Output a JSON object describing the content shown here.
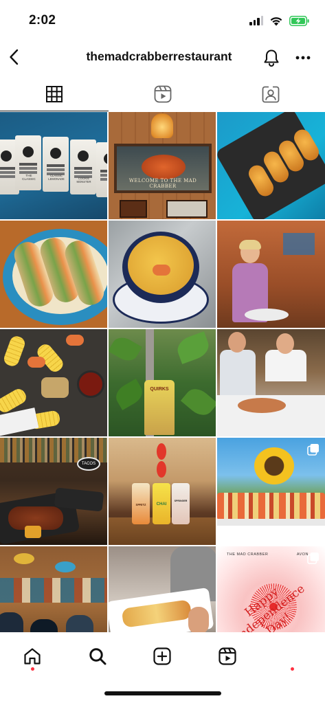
{
  "status_bar": {
    "time": "2:02",
    "signal_icon": "cellular-signal-icon",
    "wifi_icon": "wifi-icon",
    "battery_icon": "battery-charging-icon",
    "battery_color": "#32c759"
  },
  "header": {
    "back_icon": "chevron-left-icon",
    "username": "themadcrabberrestaurant",
    "notifications_icon": "bell-icon",
    "more_icon": "more-horizontal-icon"
  },
  "tabs": [
    {
      "name": "posts",
      "icon": "grid-icon",
      "active": true
    },
    {
      "name": "reels",
      "icon": "reels-icon",
      "active": false
    },
    {
      "name": "tagged",
      "icon": "tagged-person-icon",
      "active": false
    }
  ],
  "posts": [
    {
      "subject": "coffee bags",
      "labels": [
        "THE CLASSIC",
        "CLASSIC LEMONADE",
        "COOKIE MONSTER"
      ]
    },
    {
      "subject": "welcome sign",
      "sign_text": "WELCOME TO THE MAD CRABBER"
    },
    {
      "subject": "stuffed potatoes"
    },
    {
      "subject": "tacos"
    },
    {
      "subject": "soup bowl"
    },
    {
      "subject": "server with plate"
    },
    {
      "subject": "seafood boil"
    },
    {
      "subject": "garden plants",
      "bag_text": "QUIRKS"
    },
    {
      "subject": "diners at table"
    },
    {
      "subject": "bar with platters",
      "bar_text": "TACOS"
    },
    {
      "subject": "drink cans",
      "can_text": [
        "SPRITZ",
        "CHAI",
        "SPRINGER"
      ]
    },
    {
      "subject": "sunflower platter",
      "multi": true
    },
    {
      "subject": "restaurant crowd"
    },
    {
      "subject": "waffle plate"
    },
    {
      "subject": "independence day graphic",
      "multi": true,
      "top_left": "THE MAD CRABBER",
      "top_right": "AVON",
      "headline": "Happy Independence Day!"
    }
  ],
  "bottom_nav": [
    {
      "name": "home",
      "icon": "home-icon",
      "notification_dot": true
    },
    {
      "name": "search",
      "icon": "search-icon",
      "notification_dot": false
    },
    {
      "name": "create",
      "icon": "add-post-icon",
      "notification_dot": false
    },
    {
      "name": "reels",
      "icon": "reels-icon",
      "notification_dot": false
    },
    {
      "name": "profile",
      "icon": "profile-icon",
      "notification_dot": true
    }
  ],
  "colors": {
    "accent_dot": "#ff3040",
    "text": "#111111"
  }
}
